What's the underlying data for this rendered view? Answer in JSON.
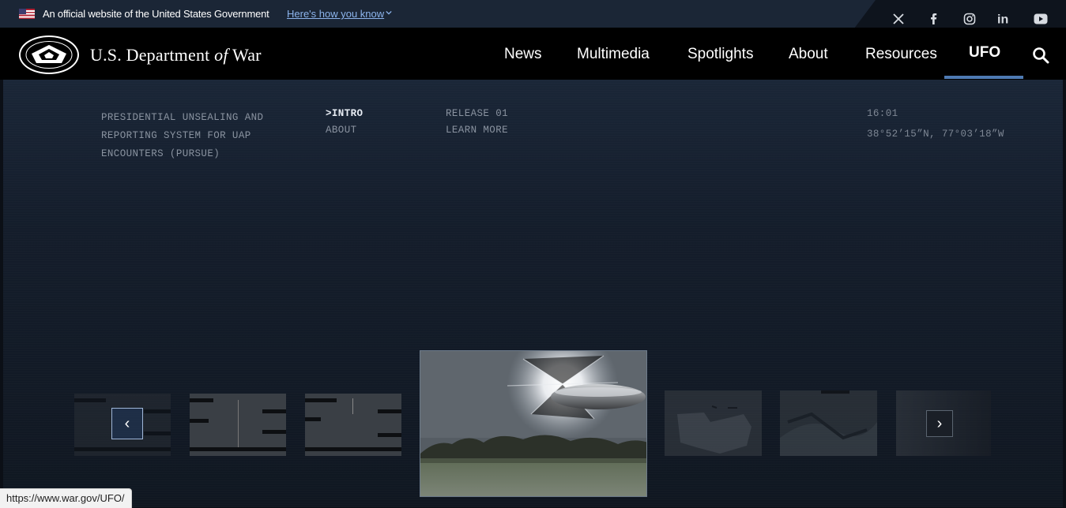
{
  "gov_banner": {
    "text": "An official website of the United States Government",
    "link": "Here's how you know"
  },
  "social": [
    "x-icon",
    "facebook-icon",
    "instagram-icon",
    "linkedin-icon",
    "youtube-icon"
  ],
  "header": {
    "brand_prefix": "U.S. Department ",
    "brand_of": "of",
    "brand_suffix": " War",
    "nav": [
      "News",
      "Multimedia",
      "Spotlights",
      "About",
      "Resources",
      "UFO"
    ],
    "active_nav": "UFO"
  },
  "hero": {
    "description": "PRESIDENTIAL UNSEALING AND REPORTING SYSTEM FOR UAP ENCOUNTERS (PURSUE)",
    "menu_col1": [
      ">INTRO",
      "ABOUT"
    ],
    "menu_col2": [
      "RELEASE 01",
      "LEARN MORE"
    ],
    "time": "16:01",
    "coordinates": "38°52’15”N, 77°03’18”W"
  },
  "carousel": {
    "prev_label": "‹",
    "next_label": "›"
  },
  "status_bar": {
    "url": "https://www.war.gov/UFO/"
  },
  "colors": {
    "gov_banner_bg": "#1b2636",
    "nav_bg": "#000000",
    "active_underline": "#4e7ab3",
    "link": "#8cb4ec"
  }
}
